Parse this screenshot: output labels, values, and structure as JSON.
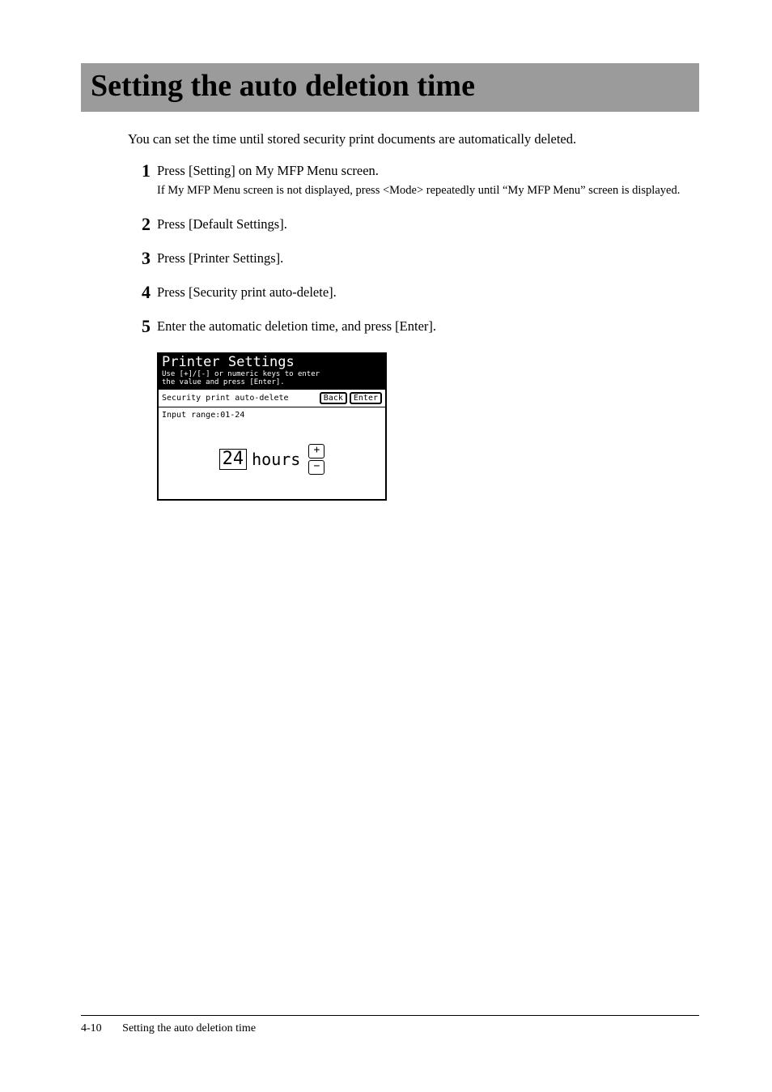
{
  "title": "Setting the auto deletion time",
  "intro": "You can set the time until stored security print documents are automatically deleted.",
  "steps": [
    {
      "num": "1",
      "text": "Press [Setting] on My MFP Menu screen.",
      "sub": "If My MFP Menu screen is not displayed, press <Mode> repeatedly until “My MFP Menu” screen is displayed."
    },
    {
      "num": "2",
      "text": "Press [Default Settings]."
    },
    {
      "num": "3",
      "text": "Press [Printer Settings]."
    },
    {
      "num": "4",
      "text": "Press [Security print auto-delete]."
    },
    {
      "num": "5",
      "text": "Enter the automatic deletion time, and press [Enter]."
    }
  ],
  "lcd": {
    "title": "Printer Settings",
    "sub1": "Use [+]/[-] or numeric keys to enter",
    "sub2": "the value and press [Enter].",
    "setting_label": "Security print auto-delete",
    "back": "Back",
    "enter": "Enter",
    "range": "Input range:01-24",
    "value": "24",
    "units": "hours",
    "plus": "+",
    "minus": "−"
  },
  "footer": {
    "page_num": "4-10",
    "title": "Setting the auto deletion time"
  }
}
